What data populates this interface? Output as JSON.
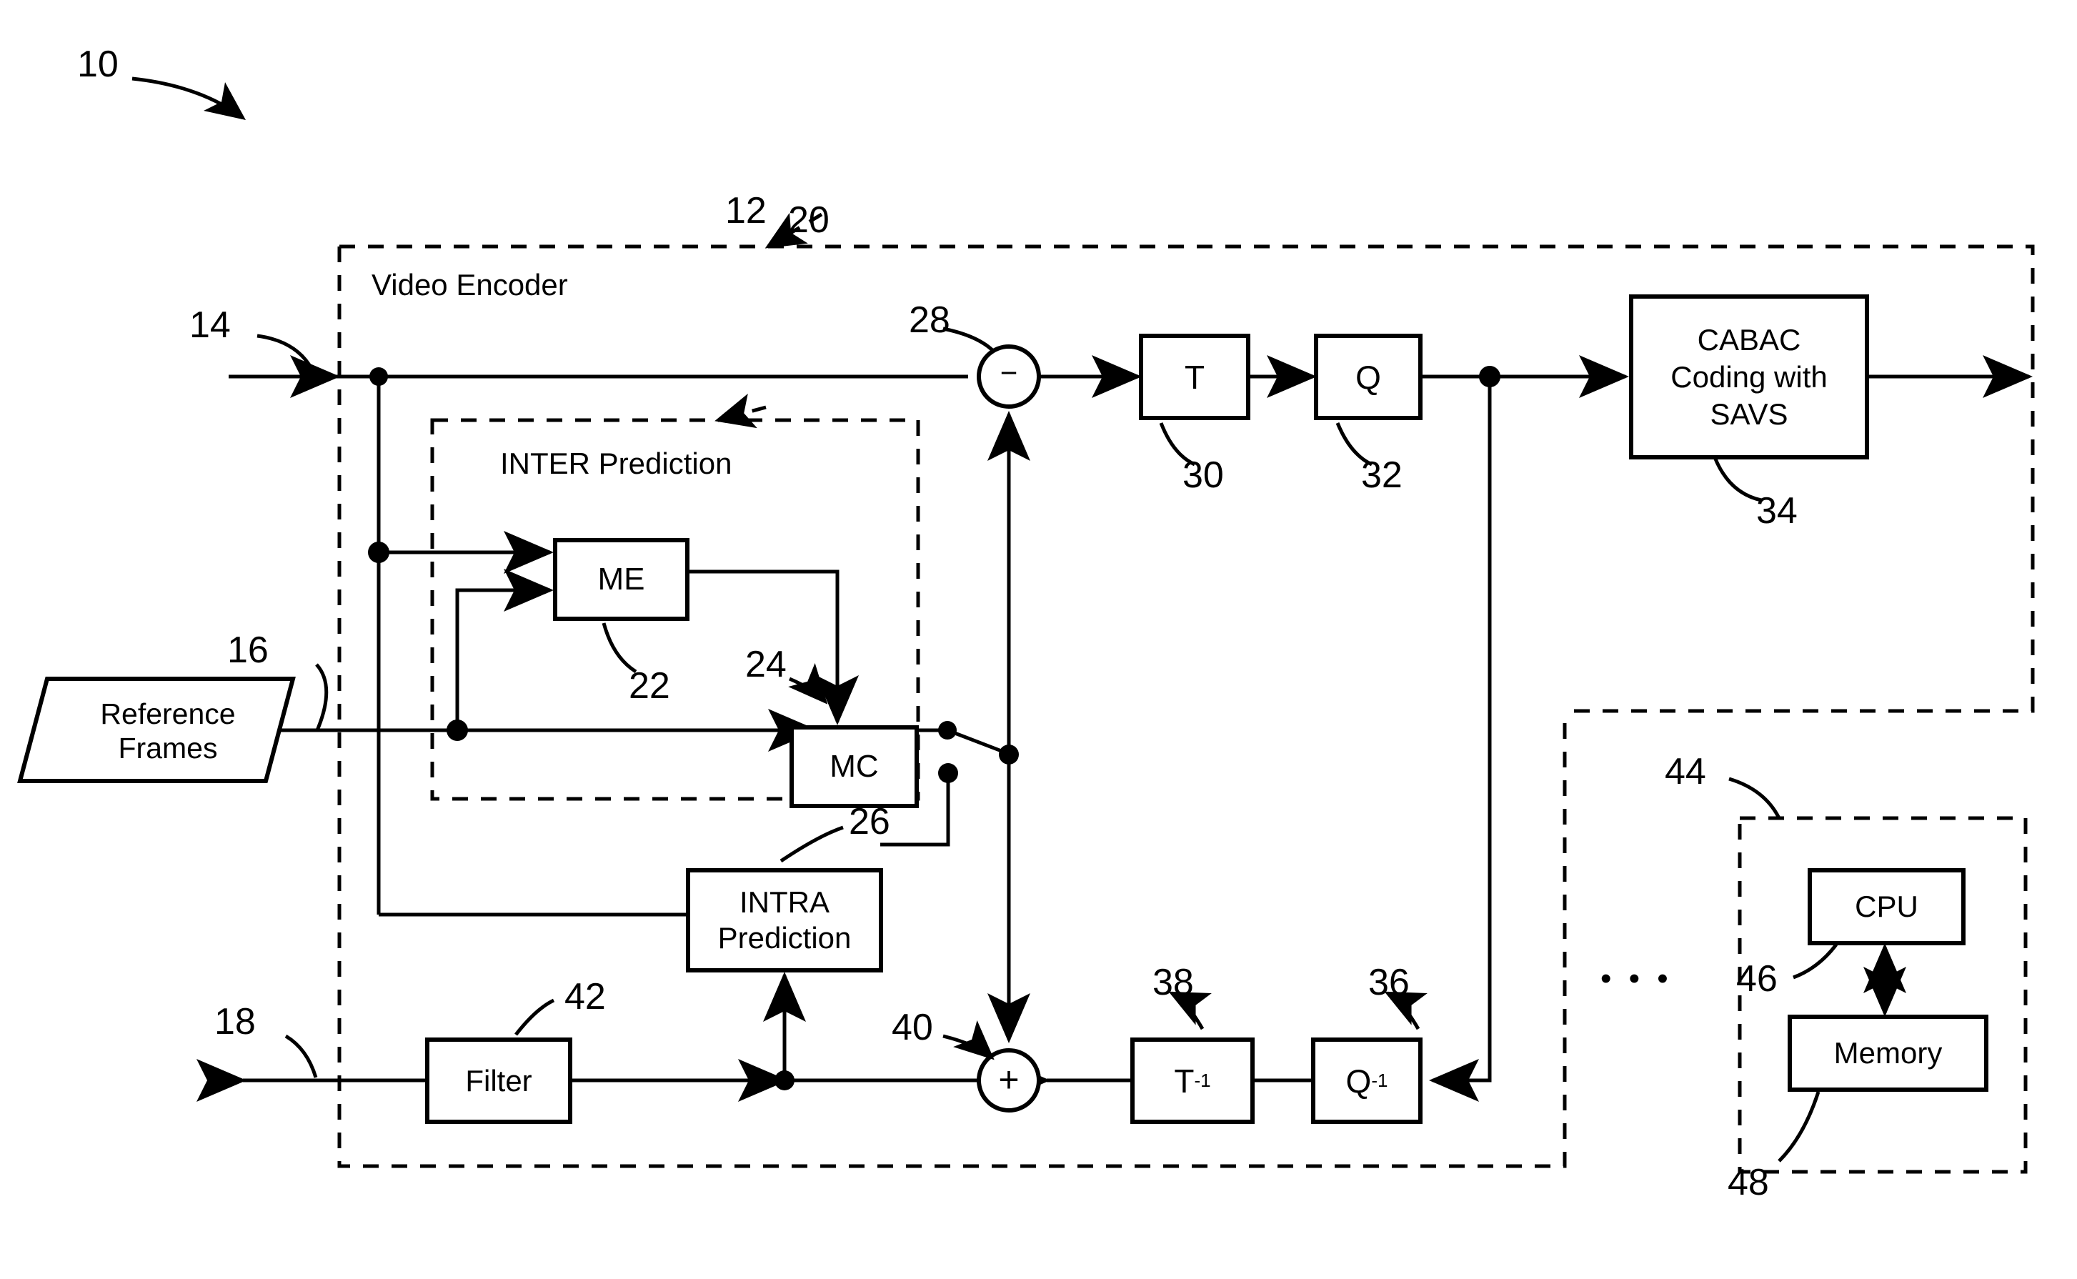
{
  "figure": {
    "figure_ref": "10",
    "encoder_ref": "12",
    "encoder_title": "Video Encoder",
    "input_ref": "14",
    "reference_frames_ref": "16",
    "reference_frames_label": "Reference\nFrames",
    "reference_frames_line1": "Reference",
    "reference_frames_line2": "Frames",
    "output_ref": "18",
    "inter_ref": "20",
    "inter_title": "INTER Prediction",
    "me_ref": "22",
    "me_label": "ME",
    "mc_ref": "24",
    "mc_label": "MC",
    "intra_ref": "26",
    "intra_line1": "INTRA",
    "intra_line2": "Prediction",
    "subtractor_ref": "28",
    "subtractor_symbol": "−",
    "transform_ref": "30",
    "transform_label": "T",
    "quantizer_ref": "32",
    "quantizer_label": "Q",
    "entropy_ref": "34",
    "entropy_line1": "CABAC",
    "entropy_line2": "Coding with",
    "entropy_line3": "SAVS",
    "inverse_quant_ref": "36",
    "inverse_quant_label": "Q",
    "inverse_quant_sup": "-1",
    "inverse_transform_ref": "38",
    "inverse_transform_label": "T",
    "inverse_transform_sup": "-1",
    "adder_ref": "40",
    "adder_symbol": "+",
    "filter_ref": "42",
    "filter_label": "Filter",
    "processor_ref": "44",
    "cpu_ref": "46",
    "cpu_label": "CPU",
    "memory_ref": "48",
    "memory_label": "Memory",
    "ellipsis": "• • •"
  }
}
